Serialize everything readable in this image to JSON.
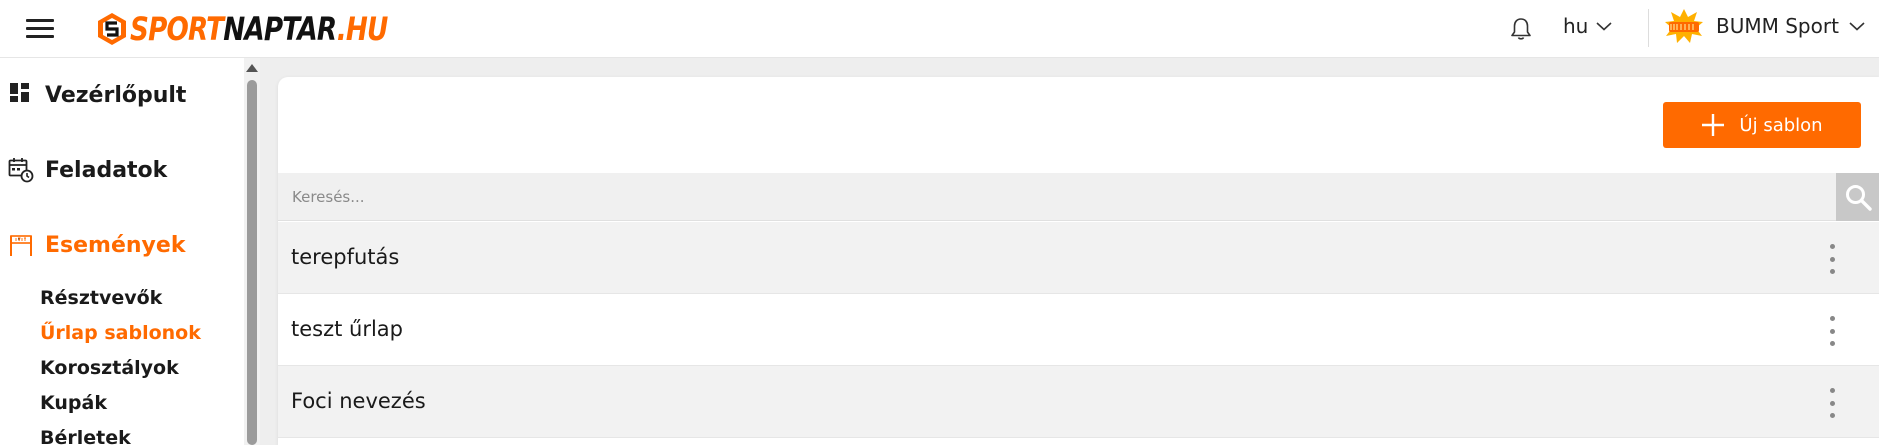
{
  "header": {
    "logo": {
      "part1": "SPORT",
      "part2": "NAPTAR",
      "part3": ".HU"
    },
    "language": "hu",
    "organization": "BUMM Sport",
    "icons": {
      "menu": "hamburger-icon",
      "notifications": "bell-icon",
      "dropdown": "chevron-down-icon"
    }
  },
  "sidebar": {
    "main_items": [
      {
        "label": "Vezérlőpult",
        "icon": "dashboard-icon",
        "active": false
      },
      {
        "label": "Feladatok",
        "icon": "calendar-clock-icon",
        "active": false
      },
      {
        "label": "Események",
        "icon": "start-gate-icon",
        "active": true
      }
    ],
    "sub_items": [
      {
        "label": "Résztvevők",
        "active": false
      },
      {
        "label": "Űrlap sablonok",
        "active": true
      },
      {
        "label": "Korosztályok",
        "active": false
      },
      {
        "label": "Kupák",
        "active": false
      },
      {
        "label": "Bérletek",
        "active": false
      }
    ]
  },
  "main": {
    "new_button_label": "Új sablon",
    "search": {
      "placeholder": "Keresés...",
      "value": ""
    },
    "rows": [
      {
        "name": "terepfutás"
      },
      {
        "name": "teszt űrlap"
      },
      {
        "name": "Foci nevezés"
      }
    ]
  },
  "colors": {
    "accent": "#ff6a00",
    "text": "#1a1a1a",
    "row_alt": "#f2f2f2",
    "search_bg": "#f0f0f0",
    "search_button": "#c8c8c8"
  }
}
